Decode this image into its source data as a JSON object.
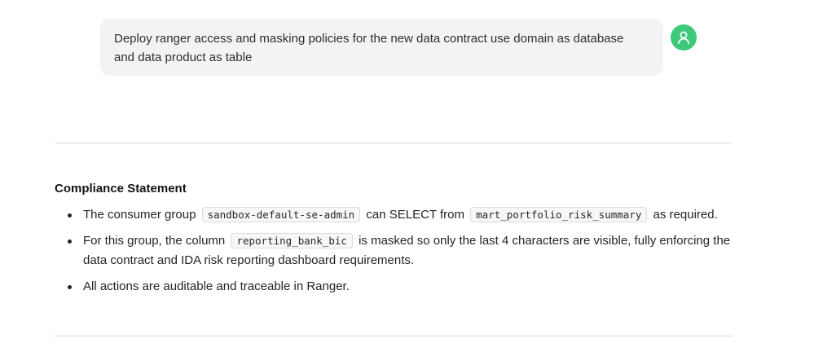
{
  "user_message": {
    "line1": "Deploy ranger access and masking policies for the new data contract use domain as database",
    "line2": "and data product as table"
  },
  "avatar": {
    "icon": "user-icon",
    "color": "#3ec97a"
  },
  "compliance": {
    "heading": "Compliance Statement",
    "item1": {
      "t1": "The consumer group",
      "c1": "sandbox-default-se-admin",
      "t2": "can SELECT from",
      "c2": "mart_portfolio_risk_summary",
      "t3": "as required."
    },
    "item2": {
      "t1": "For this group, the column",
      "c1": "reporting_bank_bic",
      "t2": "is masked so only the last 4 characters are visible, fully enforcing the",
      "line2": "data contract and IDA risk reporting dashboard requirements."
    },
    "item3": {
      "t1": "All actions are auditable and traceable in Ranger."
    }
  }
}
